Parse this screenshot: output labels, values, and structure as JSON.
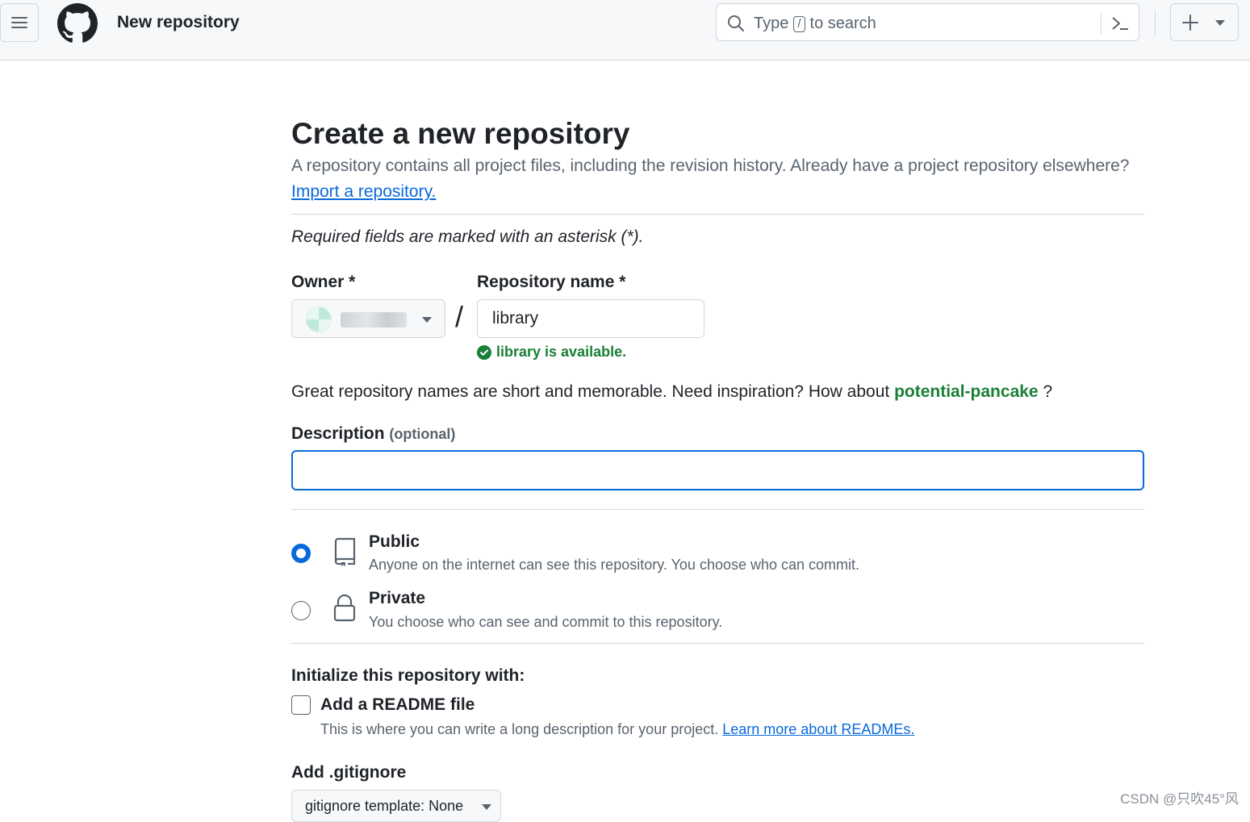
{
  "header": {
    "title": "New repository",
    "search": {
      "placeholder_prefix": "Type",
      "shortcut_key": "/",
      "placeholder_suffix": "to search"
    },
    "icons": {
      "menu": "hamburger-icon",
      "logo": "github-logo",
      "search": "search-icon",
      "command": "command-palette-icon",
      "create": "plus-icon",
      "create_caret": "triangle-down-icon"
    }
  },
  "page": {
    "title": "Create a new repository",
    "subtitle": "A repository contains all project files, including the revision history. Already have a project repository elsewhere?",
    "import_link": "Import a repository.",
    "required_note": "Required fields are marked with an asterisk (*)."
  },
  "form": {
    "owner_label": "Owner *",
    "repo_name_label": "Repository name *",
    "separator": "/",
    "repo_name_value": "library",
    "availability": "library is available.",
    "inspiration_text": "Great repository names are short and memorable. Need inspiration? How about",
    "suggestion": "potential-pancake",
    "inspiration_end": "?",
    "description_label": "Description",
    "description_optional": "(optional)",
    "description_value": ""
  },
  "visibility": [
    {
      "title": "Public",
      "description": "Anyone on the internet can see this repository. You choose who can commit.",
      "checked": true,
      "icon": "repo-icon"
    },
    {
      "title": "Private",
      "description": "You choose who can see and commit to this repository.",
      "checked": false,
      "icon": "lock-icon"
    }
  ],
  "init": {
    "title": "Initialize this repository with:",
    "readme_label": "Add a README file",
    "readme_checked": false,
    "readme_desc": "This is where you can write a long description for your project.",
    "readme_link": "Learn more about READMEs.",
    "gitignore_title": "Add .gitignore",
    "gitignore_button": "gitignore template: None"
  },
  "watermark": "CSDN @只吹45°风",
  "colors": {
    "accent": "#0969da",
    "success": "#1a7f37",
    "muted": "#59636e",
    "border": "#d0d7de"
  }
}
